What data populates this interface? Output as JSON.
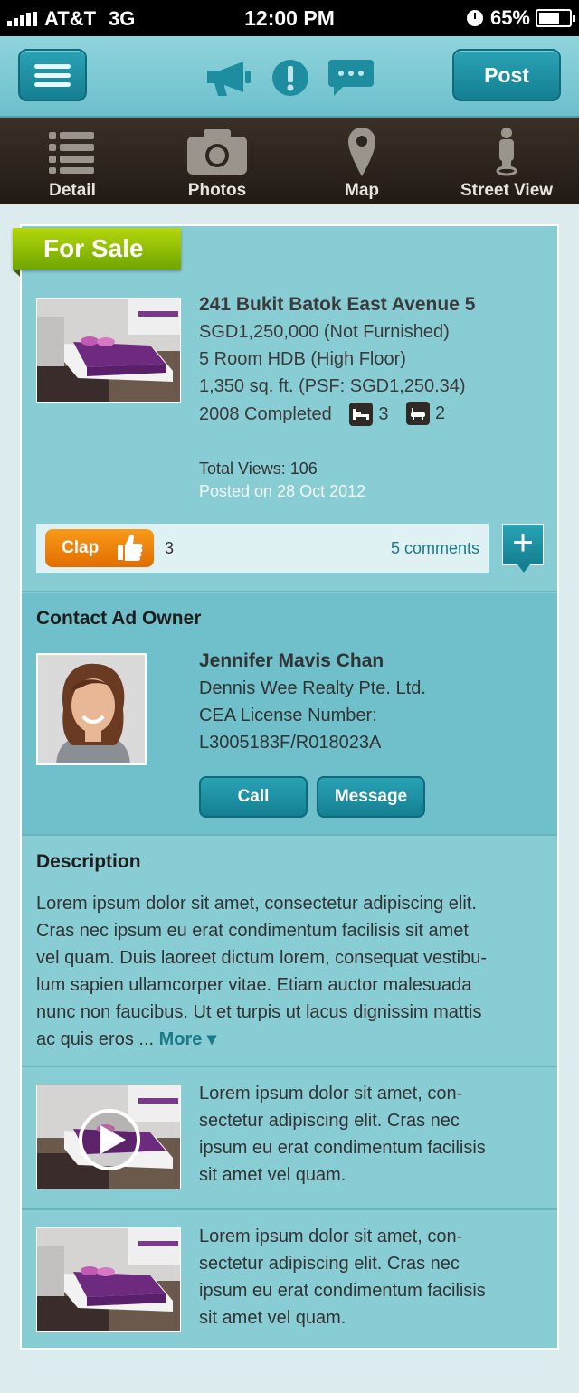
{
  "status_bar": {
    "carrier": "AT&T",
    "network": "3G",
    "time": "12:00 PM",
    "battery": "65%"
  },
  "header": {
    "post_label": "Post"
  },
  "tabs": [
    {
      "label": "Detail"
    },
    {
      "label": "Photos"
    },
    {
      "label": "Map"
    },
    {
      "label": "Street View"
    }
  ],
  "listing": {
    "badge": "For Sale",
    "address": "241 Bukit Batok East Avenue 5",
    "price": "SGD1,250,000 (Not Furnished)",
    "type": "5 Room HDB (High Floor)",
    "size": "1,350 sq. ft. (PSF: SGD1,250.34)",
    "completed": "2008 Completed",
    "bedrooms": "3",
    "bathrooms": "2",
    "total_views": "Total Views: 106",
    "posted": "Posted on 28 Oct 2012",
    "clap_label": "Clap",
    "clap_count": "3",
    "comments": "5 comments"
  },
  "contact": {
    "title": "Contact Ad Owner",
    "name": "Jennifer Mavis Chan",
    "agency": "Dennis Wee Realty Pte. Ltd.",
    "license_label": "CEA License Number:",
    "license_number": "L3005183F/R018023A",
    "call_label": "Call",
    "message_label": "Message"
  },
  "description": {
    "title": "Description",
    "lines": [
      "Lorem ipsum dolor sit amet, consectetur adipiscing elit.",
      "Cras nec ipsum eu erat condimentum facilisis sit amet",
      "vel quam. Duis laoreet dictum lorem, consequat vestibu-",
      "lum sapien ullamcorper vitae. Etiam auctor malesuada",
      "nunc non faucibus. Ut et turpis ut lacus dignissim mattis",
      "ac quis eros ..."
    ],
    "more_label": "More ▾"
  },
  "media_items": [
    {
      "lines": [
        "Lorem ipsum dolor sit amet, con-",
        "sectetur adipiscing elit. Cras nec",
        "ipsum eu erat condimentum facilisis",
        "sit amet vel quam."
      ]
    },
    {
      "lines": [
        "Lorem ipsum dolor sit amet, con-",
        "sectetur adipiscing elit. Cras nec",
        "ipsum eu erat condimentum facilisis",
        "sit amet vel quam."
      ]
    }
  ]
}
